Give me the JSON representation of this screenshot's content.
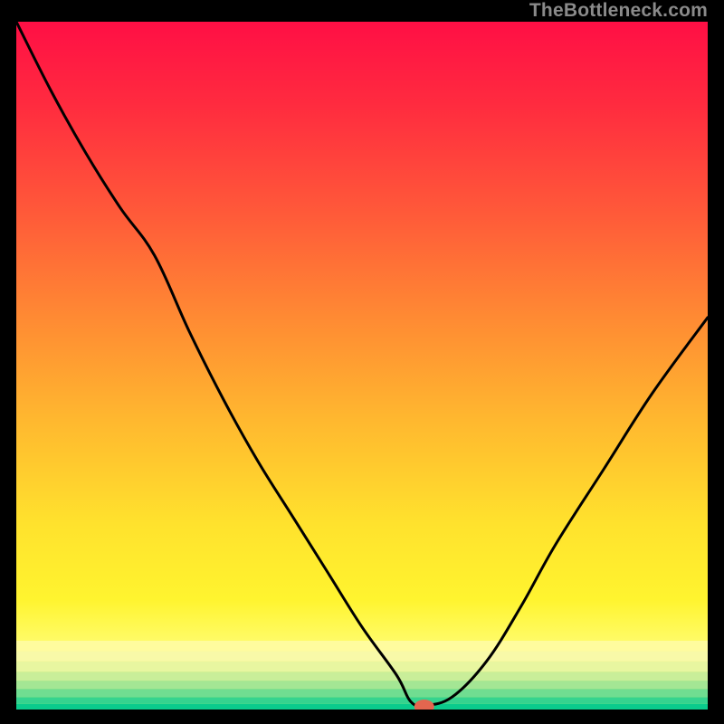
{
  "chart_data": {
    "type": "line",
    "watermark": "TheBottleneck.com",
    "title": "",
    "xlabel": "",
    "ylabel": "",
    "xlim": [
      0,
      100
    ],
    "ylim": [
      0,
      100
    ],
    "x": [
      0,
      5,
      10,
      15,
      20,
      25,
      30,
      35,
      40,
      45,
      50,
      55,
      57,
      59,
      63,
      68,
      73,
      78,
      85,
      92,
      100
    ],
    "y": [
      100,
      90,
      81,
      73,
      66,
      55,
      45,
      36,
      28,
      20,
      12,
      5,
      1.2,
      0.6,
      1.8,
      7,
      15,
      24,
      35,
      46,
      57
    ],
    "marker": {
      "x": 59,
      "y": 0.4,
      "color": "#e3664f"
    },
    "gradient_stops": [
      {
        "offset": 0.0,
        "color": "#ff0f45"
      },
      {
        "offset": 0.12,
        "color": "#ff2b3f"
      },
      {
        "offset": 0.28,
        "color": "#ff5a39"
      },
      {
        "offset": 0.43,
        "color": "#ff8a33"
      },
      {
        "offset": 0.58,
        "color": "#ffb82f"
      },
      {
        "offset": 0.73,
        "color": "#ffe22d"
      },
      {
        "offset": 0.84,
        "color": "#fff42f"
      },
      {
        "offset": 0.9,
        "color": "#fffb66"
      }
    ],
    "bottom_bands": [
      {
        "from": 0.9,
        "to": 0.915,
        "color": "#fffc9e"
      },
      {
        "from": 0.915,
        "to": 0.93,
        "color": "#f8f9a8"
      },
      {
        "from": 0.93,
        "to": 0.945,
        "color": "#e8f6a0"
      },
      {
        "from": 0.945,
        "to": 0.958,
        "color": "#c9ee99"
      },
      {
        "from": 0.958,
        "to": 0.97,
        "color": "#a4e694"
      },
      {
        "from": 0.97,
        "to": 0.982,
        "color": "#70dd91"
      },
      {
        "from": 0.982,
        "to": 0.992,
        "color": "#35d38f"
      },
      {
        "from": 0.992,
        "to": 1.0,
        "color": "#0acb8c"
      }
    ]
  }
}
